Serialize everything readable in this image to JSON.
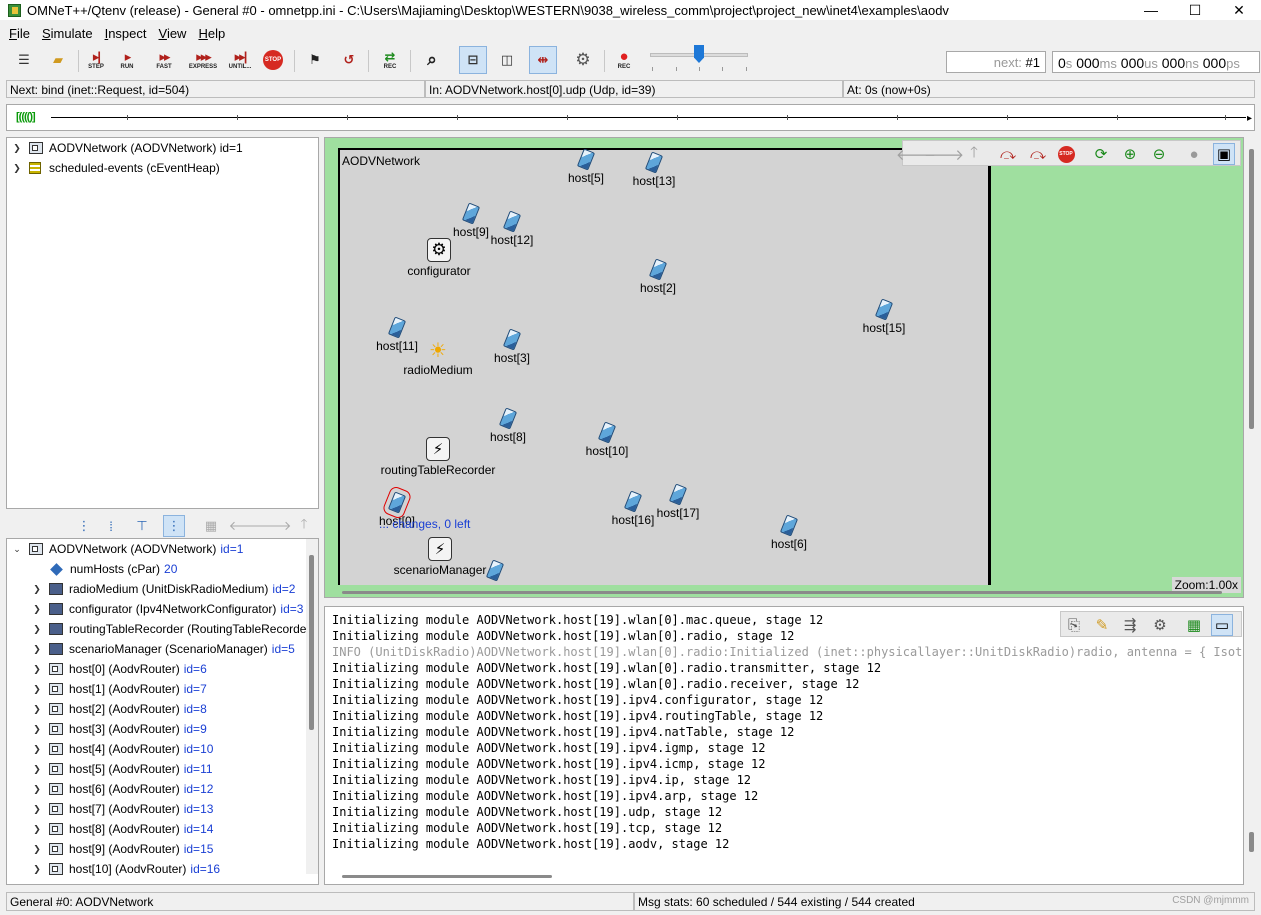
{
  "window": {
    "title": "OMNeT++/Qtenv (release) - General #0 - omnetpp.ini - C:\\Users\\Majiaming\\Desktop\\WESTERN\\9038_wireless_comm\\project\\project_new\\inet4\\examples\\aodv",
    "minimize": "—",
    "maximize": "☐",
    "close": "✕"
  },
  "menu": [
    "File",
    "Simulate",
    "Inspect",
    "View",
    "Help"
  ],
  "toolbar": {
    "step": "STEP",
    "run": "RUN",
    "fast": "FAST",
    "express": "EXPRESS",
    "until": "UNTIL...",
    "stop": "STOP",
    "rec": "REC",
    "rec2": "REC",
    "next_label": "next: ",
    "next_value": "#1",
    "time": {
      "s": "0",
      "ms": "000",
      "us": "000",
      "ns": "000",
      "ps": "000"
    },
    "time_units": {
      "s": "s",
      "ms": "ms",
      "us": "us",
      "ns": "ns",
      "ps": "ps"
    }
  },
  "status": {
    "next": "Next: bind (inet::Request, id=504)",
    "in": "In: AODVNetwork.host[0].udp (Udp, id=39)",
    "at": "At: 0s (now+0s)"
  },
  "timeline": {
    "badge": "[(((()]"
  },
  "object_tree": [
    {
      "label": "AODVNetwork (AODVNetwork) id=1",
      "icon": "module"
    },
    {
      "label": "scheduled-events (cEventHeap)",
      "icon": "heap"
    }
  ],
  "inspector_tree": {
    "root": {
      "label": "AODVNetwork (AODVNetwork)",
      "id": "id=1"
    },
    "children": [
      {
        "label": "numHosts (cPar)",
        "id": "20",
        "icon": "param",
        "expandable": false
      },
      {
        "label": "radioMedium (UnitDiskRadioMedium)",
        "id": "id=2",
        "icon": "simple",
        "expandable": true
      },
      {
        "label": "configurator (Ipv4NetworkConfigurator)",
        "id": "id=3",
        "icon": "simple",
        "expandable": true
      },
      {
        "label": "routingTableRecorder (RoutingTableRecorder)",
        "id": "id=4",
        "icon": "simple",
        "expandable": true
      },
      {
        "label": "scenarioManager (ScenarioManager)",
        "id": "id=5",
        "icon": "simple",
        "expandable": true
      },
      {
        "label": "host[0] (AodvRouter)",
        "id": "id=6",
        "icon": "module",
        "expandable": true
      },
      {
        "label": "host[1] (AodvRouter)",
        "id": "id=7",
        "icon": "module",
        "expandable": true
      },
      {
        "label": "host[2] (AodvRouter)",
        "id": "id=8",
        "icon": "module",
        "expandable": true
      },
      {
        "label": "host[3] (AodvRouter)",
        "id": "id=9",
        "icon": "module",
        "expandable": true
      },
      {
        "label": "host[4] (AodvRouter)",
        "id": "id=10",
        "icon": "module",
        "expandable": true
      },
      {
        "label": "host[5] (AodvRouter)",
        "id": "id=11",
        "icon": "module",
        "expandable": true
      },
      {
        "label": "host[6] (AodvRouter)",
        "id": "id=12",
        "icon": "module",
        "expandable": true
      },
      {
        "label": "host[7] (AodvRouter)",
        "id": "id=13",
        "icon": "module",
        "expandable": true
      },
      {
        "label": "host[8] (AodvRouter)",
        "id": "id=14",
        "icon": "module",
        "expandable": true
      },
      {
        "label": "host[9] (AodvRouter)",
        "id": "id=15",
        "icon": "module",
        "expandable": true
      },
      {
        "label": "host[10] (AodvRouter)",
        "id": "id=16",
        "icon": "module",
        "expandable": true
      }
    ]
  },
  "network": {
    "title": "AODVNetwork",
    "zoom": "Zoom:1.00x",
    "changes": "... changes, 0 left",
    "submodules": [
      {
        "name": "host[5]",
        "type": "host"
      },
      {
        "name": "host[13]",
        "type": "host"
      },
      {
        "name": "host[9]",
        "type": "host"
      },
      {
        "name": "host[12]",
        "type": "host"
      },
      {
        "name": "configurator",
        "type": "configurator"
      },
      {
        "name": "host[2]",
        "type": "host"
      },
      {
        "name": "host[15]",
        "type": "host"
      },
      {
        "name": "host[11]",
        "type": "host"
      },
      {
        "name": "radioMedium",
        "type": "radio"
      },
      {
        "name": "host[3]",
        "type": "host"
      },
      {
        "name": "host[8]",
        "type": "host"
      },
      {
        "name": "host[10]",
        "type": "host"
      },
      {
        "name": "routingTableRecorder",
        "type": "recorder"
      },
      {
        "name": "host[0]",
        "type": "host",
        "selected": true
      },
      {
        "name": "host[16]",
        "type": "host"
      },
      {
        "name": "host[17]",
        "type": "host"
      },
      {
        "name": "host[6]",
        "type": "host"
      },
      {
        "name": "scenarioManager",
        "type": "recorder"
      },
      {
        "name": "",
        "type": "host"
      }
    ]
  },
  "log": [
    {
      "text": "Initializing module AODVNetwork.host[19].wlan[0].mac.queue, stage 12",
      "info": false
    },
    {
      "text": "Initializing module AODVNetwork.host[19].wlan[0].radio, stage 12",
      "info": false
    },
    {
      "text": "INFO (UnitDiskRadio)AODVNetwork.host[19].wlan[0].radio:Initialized (inet::physicallayer::UnitDiskRadio)radio, antenna = { Isotropic",
      "info": true
    },
    {
      "text": "Initializing module AODVNetwork.host[19].wlan[0].radio.transmitter, stage 12",
      "info": false
    },
    {
      "text": "Initializing module AODVNetwork.host[19].wlan[0].radio.receiver, stage 12",
      "info": false
    },
    {
      "text": "Initializing module AODVNetwork.host[19].ipv4.configurator, stage 12",
      "info": false
    },
    {
      "text": "Initializing module AODVNetwork.host[19].ipv4.routingTable, stage 12",
      "info": false
    },
    {
      "text": "Initializing module AODVNetwork.host[19].ipv4.natTable, stage 12",
      "info": false
    },
    {
      "text": "Initializing module AODVNetwork.host[19].ipv4.igmp, stage 12",
      "info": false
    },
    {
      "text": "Initializing module AODVNetwork.host[19].ipv4.icmp, stage 12",
      "info": false
    },
    {
      "text": "Initializing module AODVNetwork.host[19].ipv4.ip, stage 12",
      "info": false
    },
    {
      "text": "Initializing module AODVNetwork.host[19].ipv4.arp, stage 12",
      "info": false
    },
    {
      "text": "Initializing module AODVNetwork.host[19].udp, stage 12",
      "info": false
    },
    {
      "text": "Initializing module AODVNetwork.host[19].tcp, stage 12",
      "info": false
    },
    {
      "text": "Initializing module AODVNetwork.host[19].aodv, stage 12",
      "info": false
    }
  ],
  "bottom_status": {
    "left": "General #0: AODVNetwork",
    "right": "Msg stats: 60 scheduled / 544 existing / 544 created",
    "watermark": "CSDN @mjmmm"
  }
}
